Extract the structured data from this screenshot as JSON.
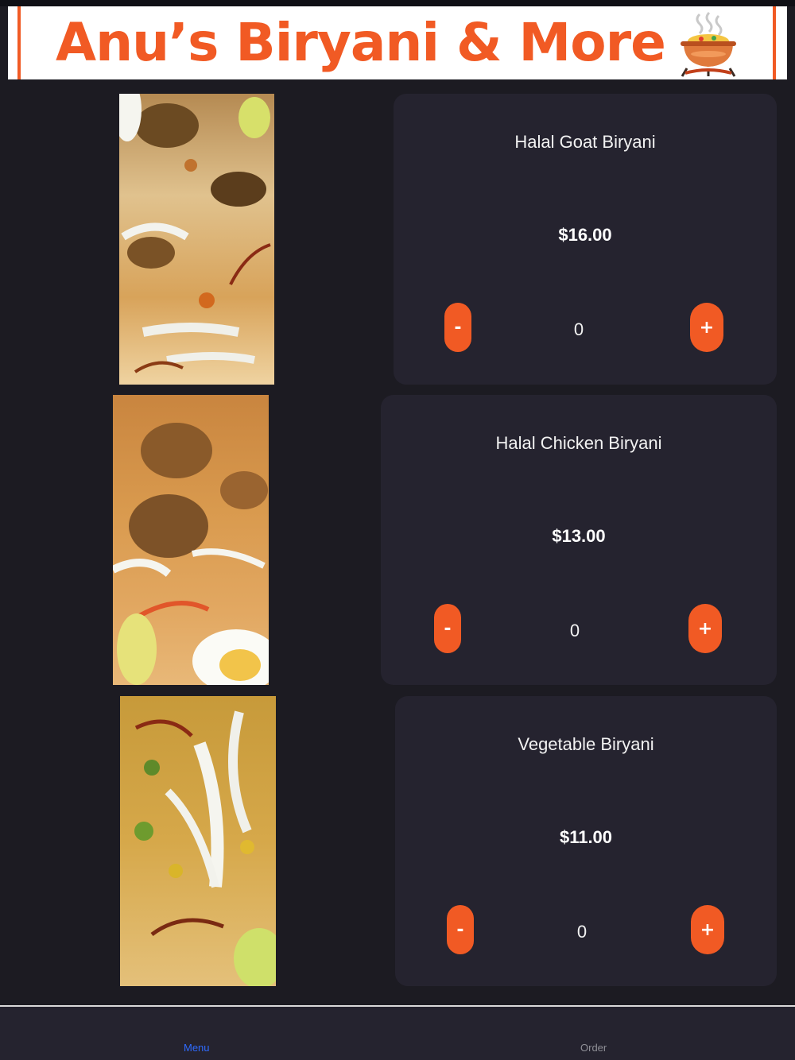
{
  "header": {
    "title": "Anu’s Biryani & More",
    "logo_icon": "biryani-pot-icon",
    "accent_color": "#f15a24"
  },
  "menu": {
    "items": [
      {
        "name": "Halal Goat Biryani",
        "price": "$16.00",
        "quantity": "0",
        "minus_label": "-",
        "plus_label": "+",
        "image": "goat-biryani-photo"
      },
      {
        "name": "Halal Chicken Biryani",
        "price": "$13.00",
        "quantity": "0",
        "minus_label": "-",
        "plus_label": "+",
        "image": "chicken-biryani-photo"
      },
      {
        "name": "Vegetable Biryani",
        "price": "$11.00",
        "quantity": "0",
        "minus_label": "-",
        "plus_label": "+",
        "image": "vegetable-biryani-photo"
      }
    ]
  },
  "tabbar": {
    "tabs": [
      {
        "label": "Menu",
        "active": true,
        "color": "#2f6bff"
      },
      {
        "label": "Order",
        "active": false,
        "color": "#8f8f96"
      }
    ]
  }
}
